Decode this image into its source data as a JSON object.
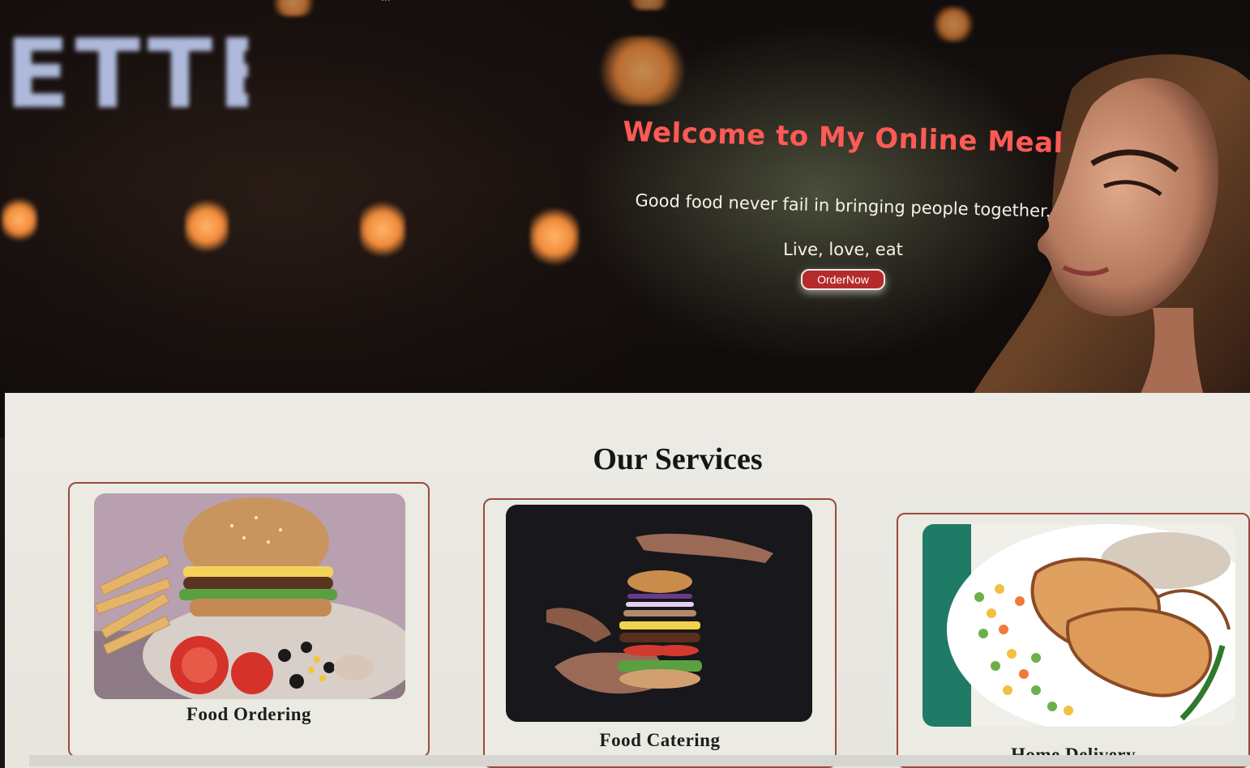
{
  "hero": {
    "title": "Welcome to My Online Meal",
    "subtitle": "Good food never fail in bringing people together.",
    "tagline": "Live, love, eat",
    "order_button": "OrderNow",
    "sign_text": "ETTE",
    "nav_fragment": "..."
  },
  "services": {
    "heading": "Our Services",
    "items": [
      {
        "label": "Food Ordering",
        "image": "burger-plate-image"
      },
      {
        "label": "Food Catering",
        "image": "floating-burger-image"
      },
      {
        "label": "Home Delivery",
        "image": "grilled-chicken-image"
      }
    ]
  },
  "colors": {
    "title_red": "#ff5a55",
    "button_red": "#b52a2a",
    "card_border": "#9a4a3e",
    "section_bg": "#ecebe5"
  }
}
